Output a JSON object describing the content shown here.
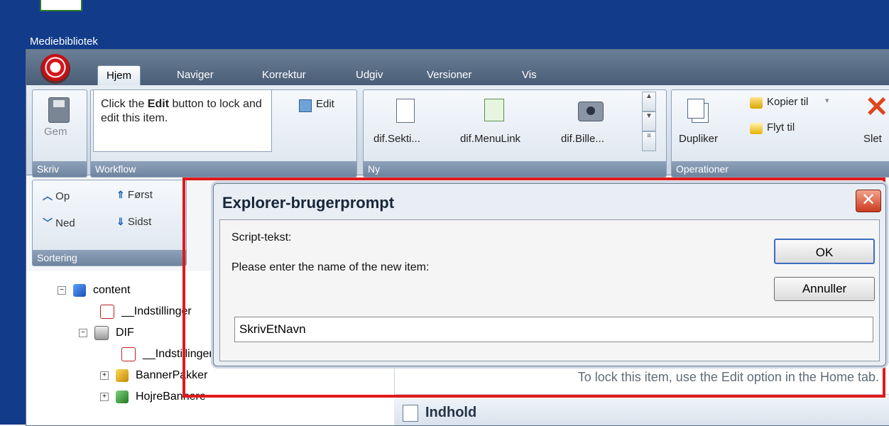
{
  "desktop": {
    "label": "Mediebibliotek"
  },
  "tabs": [
    "Hjem",
    "Naviger",
    "Korrektur",
    "Udgiv",
    "Versioner",
    "Vis"
  ],
  "ribbon": {
    "write": {
      "button": "Gem",
      "label": "Skriv"
    },
    "workflow": {
      "note_before": "Click the ",
      "note_bold": "Edit",
      "note_after": " button to lock and edit this item.",
      "edit": "Edit",
      "label": "Workflow"
    },
    "new": {
      "items": [
        "dif.Sekti...",
        "dif.MenuLink",
        "dif.Bille..."
      ],
      "label": "Ny"
    },
    "operations": {
      "duplicate": "Dupliker",
      "copy_to": "Kopier til",
      "move_to": "Flyt til",
      "delete": "Slet",
      "label": "Operationer"
    },
    "sorting": {
      "up": "Op",
      "first": "Først",
      "down": "Ned",
      "last": "Sidst",
      "label": "Sortering"
    }
  },
  "tree": [
    {
      "label": "content",
      "icon": "blue"
    },
    {
      "label": "__Indstillinger",
      "icon": "check"
    },
    {
      "label": "DIF",
      "icon": "db"
    },
    {
      "label": "__Indstillinger.Org",
      "icon": "check"
    },
    {
      "label": "BannerPakker",
      "icon": "gold"
    },
    {
      "label": "HojreBannere",
      "icon": "green"
    }
  ],
  "content": {
    "lock_message": "To lock this item, use the Edit option in the Home tab.",
    "section_title": "Indhold"
  },
  "dialog": {
    "title": "Explorer-brugerprompt",
    "script_label": "Script-tekst:",
    "prompt": "Please enter the name of the new item:",
    "ok": "OK",
    "cancel": "Annuller",
    "input_value": "SkrivEtNavn"
  }
}
